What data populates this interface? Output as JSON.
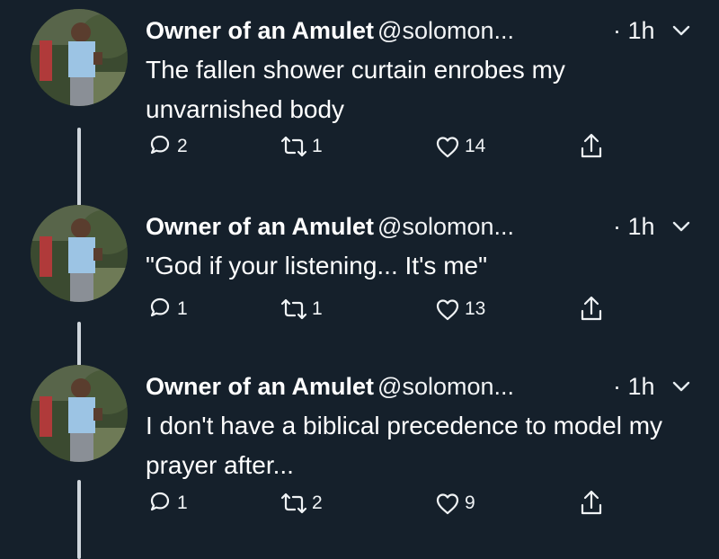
{
  "tweets": [
    {
      "display_name": "Owner of an Amulet",
      "handle": "@solomon...",
      "time": "· 1h",
      "text": "The fallen shower curtain enrobes my unvarnished body",
      "replies": "2",
      "retweets": "1",
      "likes": "14"
    },
    {
      "display_name": "Owner of an Amulet",
      "handle": "@solomon...",
      "time": "· 1h",
      "text": "\"God if your listening... It's me\"",
      "replies": "1",
      "retweets": "1",
      "likes": "13"
    },
    {
      "display_name": "Owner of an Amulet",
      "handle": "@solomon...",
      "time": "· 1h",
      "text": "I don't have a biblical precedence to model my prayer after...",
      "replies": "1",
      "retweets": "2",
      "likes": "9"
    }
  ],
  "icons": {
    "reply": "reply-icon",
    "retweet": "retweet-icon",
    "like": "like-icon",
    "share": "share-icon",
    "menu": "chevron-down-icon"
  },
  "colors": {
    "background": "#15202b",
    "text": "#ffffff",
    "thread_line": "#cfd6dc"
  }
}
